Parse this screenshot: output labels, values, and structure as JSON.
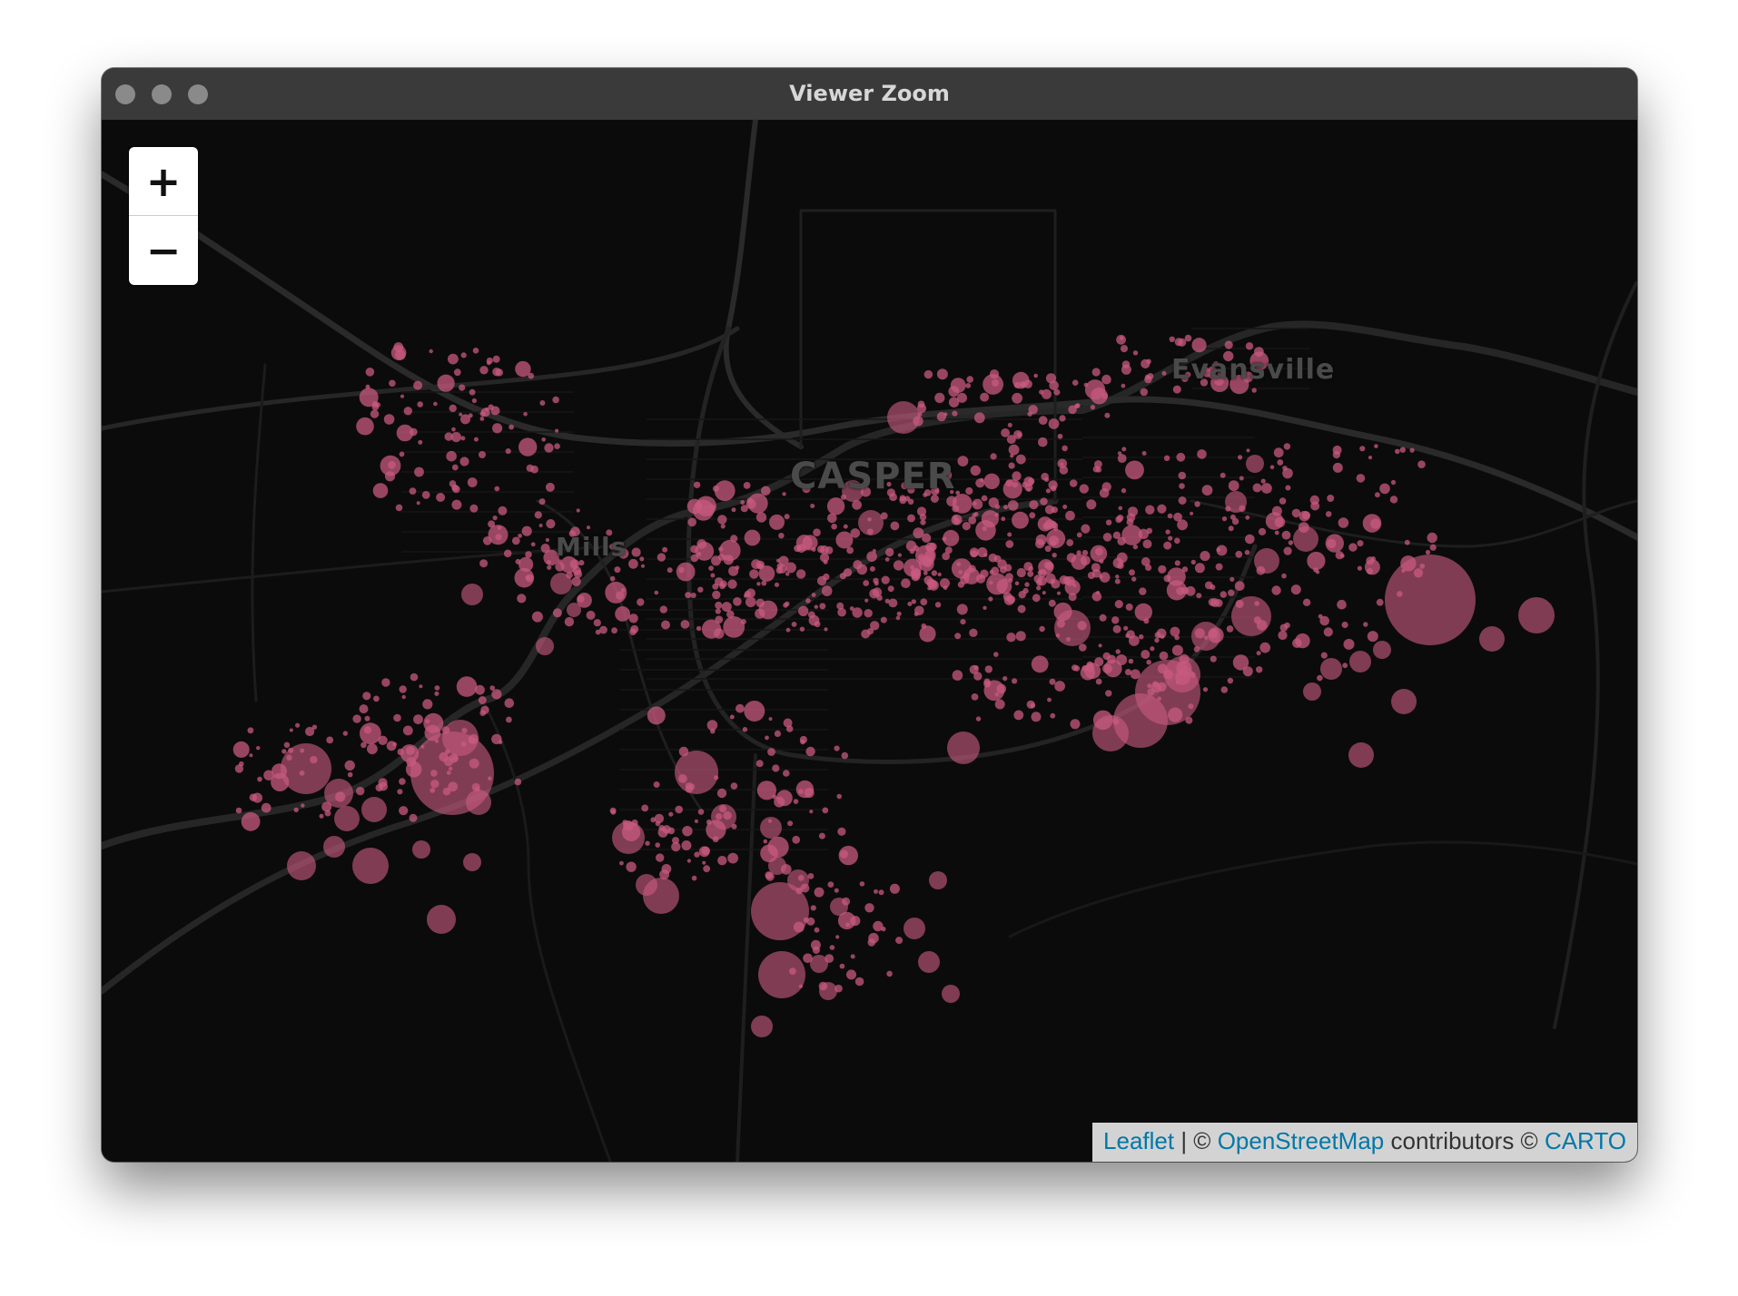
{
  "window": {
    "title": "Viewer Zoom"
  },
  "map": {
    "labels": {
      "casper": "CASPER",
      "evansville": "Evansville",
      "mills": "Mills"
    },
    "zoom": {
      "in_label": "+",
      "out_label": "−"
    },
    "attribution": {
      "leaflet": "Leaflet",
      "sep": " | © ",
      "osm": "OpenStreetMap",
      "contributors": " contributors © ",
      "carto": "CARTO"
    },
    "marker_color": "#c85a80",
    "road_color": "#222222",
    "background_color": "#0b0b0b"
  }
}
